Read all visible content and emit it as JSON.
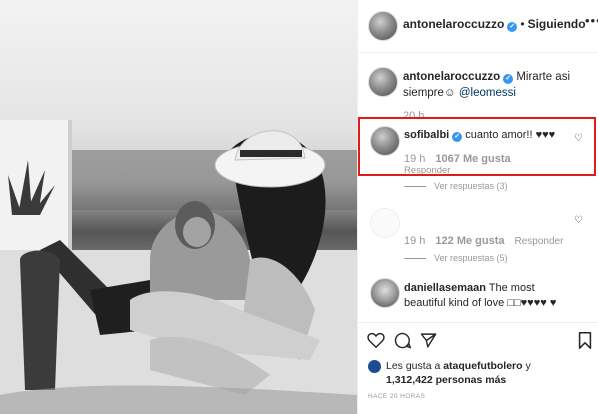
{
  "post": {
    "author": "antonelaroccuzzo",
    "follow_status": "Siguiendo",
    "more_icon": "more-horizontal-icon",
    "caption": {
      "username": "antonelaroccuzzo",
      "text_before": " Mirarte asi siempre",
      "emoji": "☺",
      "mention": "@leomessi",
      "time": "20 h"
    }
  },
  "comments": [
    {
      "username": "sofibalbi",
      "text": " cuanto amor!! ♥♥♥",
      "time": "19 h",
      "likes": "1067 Me gusta",
      "reply": "Responder",
      "view_replies": "Ver respuestas (3)",
      "highlighted": true
    },
    {
      "username": "",
      "text": "",
      "time": "19 h",
      "likes": "122 Me gusta",
      "reply": "Responder",
      "view_replies": "Ver respuestas (5)"
    },
    {
      "username": "daniellasemaan",
      "text": " The most beautiful kind of love □□♥♥♥♥ ♥",
      "time": "",
      "likes": "",
      "reply": ""
    }
  ],
  "actions": {
    "liked_by_prefix": "Les gusta a ",
    "liked_by_user": "ataquefutbolero",
    "liked_by_and": " y",
    "liked_by_count": "1,312,422 personas más",
    "timestamp": "HACE 20 HORAS"
  },
  "colors": {
    "verified": "#3897f0",
    "highlight_border": "#e01b1b",
    "meta_gray": "#999999"
  }
}
